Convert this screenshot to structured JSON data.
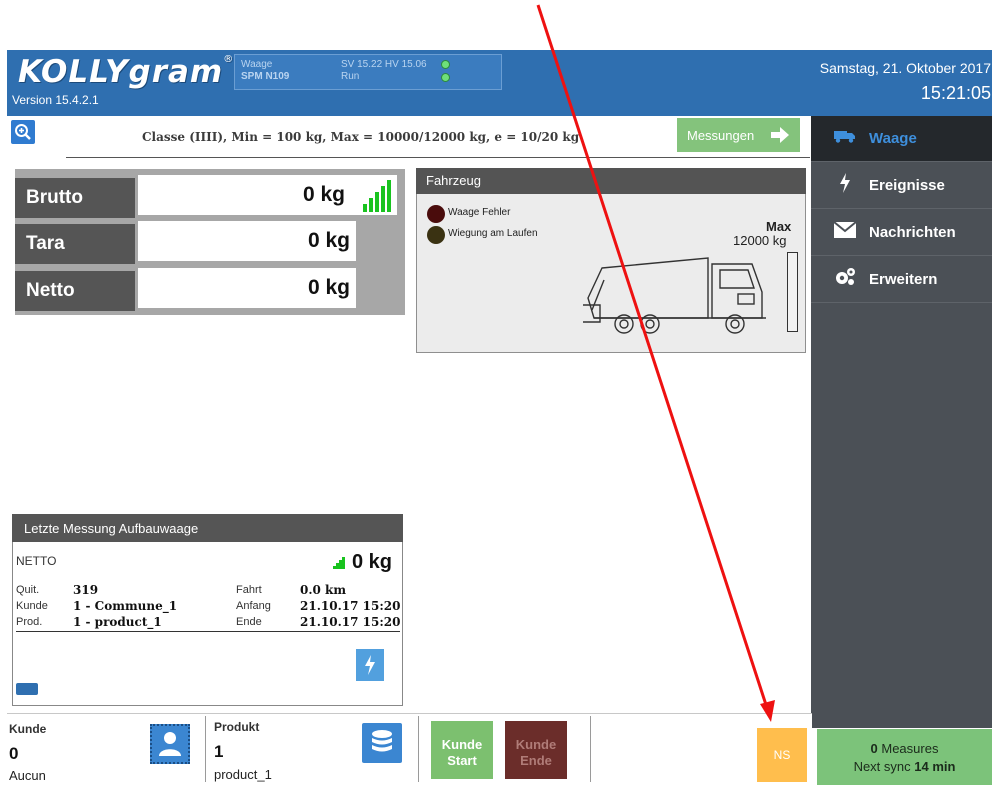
{
  "header": {
    "logo": "KOLLYgram",
    "logo_mark": "®",
    "version": "Version 15.4.2.1",
    "device_name": "Waage",
    "device_model": "SPM N109",
    "sv_hv": "SV 15.22  HV  15.06",
    "run": "Run",
    "date": "Samstag, 21. Oktober 2017",
    "time": "15:21:05"
  },
  "scale_info": {
    "class_line": "Classe (IIII), Min = 100 kg, Max = 10000/12000 kg, e = 10/20 kg",
    "measurements_button": "Messungen"
  },
  "nav": {
    "items": [
      {
        "label": "Waage",
        "icon": "truck-icon",
        "active": true
      },
      {
        "label": "Ereignisse",
        "icon": "lightning-icon",
        "active": false
      },
      {
        "label": "Nachrichten",
        "icon": "envelope-icon",
        "active": false
      },
      {
        "label": "Erweitern",
        "icon": "gears-icon",
        "active": false
      }
    ]
  },
  "weights": {
    "brutto_label": "Brutto",
    "brutto_value": "0 kg",
    "tara_label": "Tara",
    "tara_value": "0 kg",
    "netto_label": "Netto",
    "netto_value": "0 kg"
  },
  "vehicle": {
    "title": "Fahrzeug",
    "status_error": "Waage Fehler",
    "status_running": "Wiegung am Laufen",
    "max_label": "Max",
    "max_value": "12000 kg"
  },
  "last_measure": {
    "title": "Letzte Messung Aufbauwaage",
    "netto_label": "NETTO",
    "netto_value": "0 kg",
    "quit_label": "Quit.",
    "quit_value": "319",
    "kunde_label": "Kunde",
    "kunde_value": "1 - Commune_1",
    "prod_label": "Prod.",
    "prod_value": "1 - product_1",
    "fahrt_label": "Fahrt",
    "fahrt_value": "0.0 km",
    "anfang_label": "Anfang",
    "anfang_value": "21.10.17 15:20",
    "ende_label": "Ende",
    "ende_value": "21.10.17 15:20"
  },
  "bottom": {
    "kunde_label": "Kunde",
    "kunde_value": "0",
    "kunde_sub": "Aucun",
    "produkt_label": "Produkt",
    "produkt_value": "1",
    "produkt_sub": "product_1",
    "kunde_start_1": "Kunde",
    "kunde_start_2": "Start",
    "kunde_ende_1": "Kunde",
    "kunde_ende_2": "Ende",
    "ns": "NS",
    "measures_count": "0",
    "measures_label": " Measures",
    "next_sync_prefix": "Next sync ",
    "next_sync_value": "14 min"
  },
  "colors": {
    "header_blue": "#2f6fb0",
    "nav_dark": "#4b5056",
    "nav_active": "#24282c",
    "accent_green": "#7cc06f",
    "accent_orange": "#ffbe4d",
    "arrow_red": "#ee1111"
  }
}
